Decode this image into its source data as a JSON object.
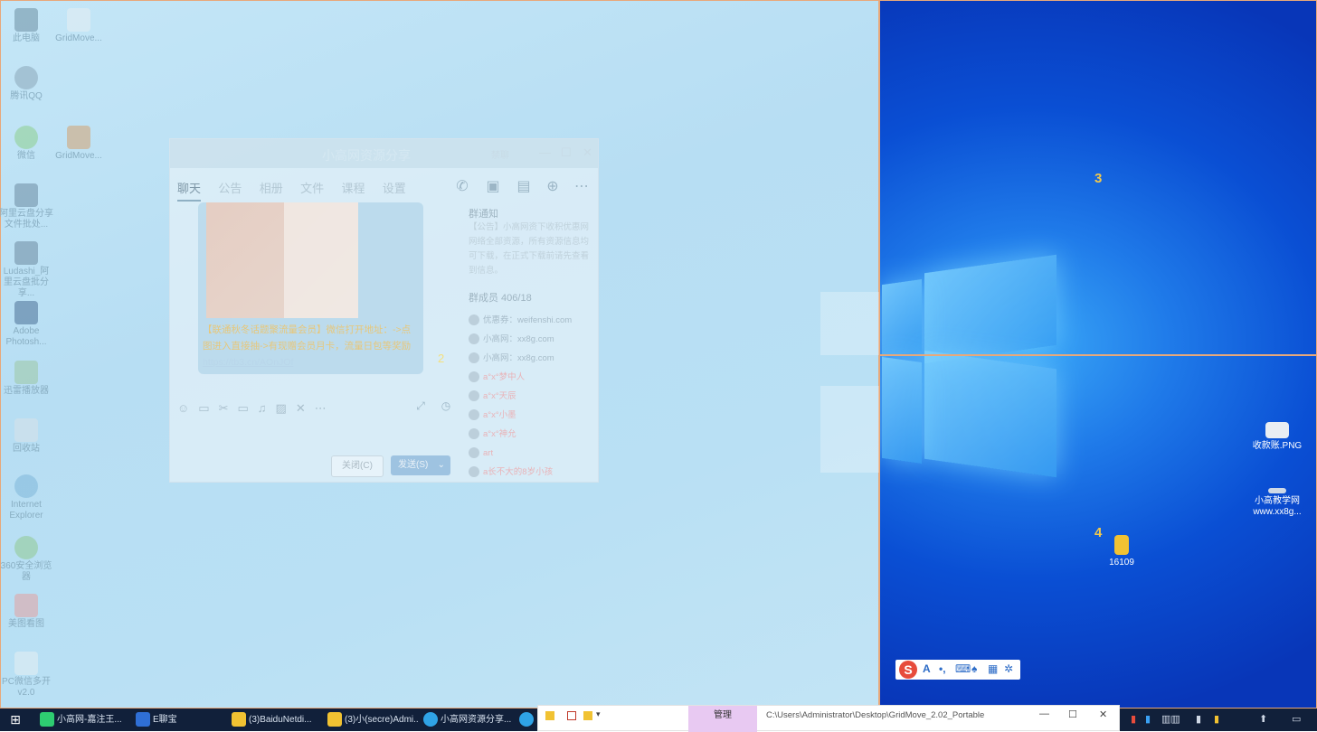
{
  "zones": {
    "zone2": "2",
    "zone3": "3",
    "zone4": "4"
  },
  "left_icons": [
    {
      "label": "此电脑"
    },
    {
      "label": "GridMove..."
    },
    {
      "label": "腾讯QQ"
    },
    {
      "label": "微信"
    },
    {
      "label": "GridMove..."
    },
    {
      "label": "阿里云盘分享文件批处..."
    },
    {
      "label": "Ludashi_阿里云盘批分享..."
    },
    {
      "label": "Adobe Photosh..."
    },
    {
      "label": "迅雷播放器"
    },
    {
      "label": "回收站"
    },
    {
      "label": "Internet Explorer"
    },
    {
      "label": "360安全浏览器"
    },
    {
      "label": "美图看图"
    },
    {
      "label": "PC微信多开 v2.0"
    }
  ],
  "right_icons": [
    {
      "label": "收款账.PNG"
    },
    {
      "label": "小高教学网 www.xx8g..."
    },
    {
      "label": "16109"
    }
  ],
  "chat": {
    "title": "小高网资源分享",
    "title_tag": "禁聊",
    "tabs": [
      "聊天",
      "公告",
      "相册",
      "文件",
      "课程",
      "设置"
    ],
    "message_text": "【联通秋冬话题聚流量会员】微信打开地址：->点图进入直接抽->有现赠会员月卡，流量日包等奖励",
    "message_link": "https://tb3.cn/AOnJOf",
    "read_count": "2",
    "group_notice_title": "群通知",
    "group_notice_text": "【公告】小高网资下收积优惠网网络全部资源，所有资源信息均可下载，在正式下载前请先查看到信息。",
    "members_title": "群成员 406/18",
    "members": [
      {
        "name": "优惠券：weifenshi.com",
        "pink": false
      },
      {
        "name": "小高网：xx8g.com",
        "pink": false
      },
      {
        "name": "小高网：xx8g.com",
        "pink": false
      },
      {
        "name": "a°x°梦中人",
        "pink": true
      },
      {
        "name": "a°x°天辰",
        "pink": true
      },
      {
        "name": "a°x°小墨",
        "pink": true
      },
      {
        "name": "a°x°神允",
        "pink": true
      },
      {
        "name": "art",
        "pink": true
      },
      {
        "name": "a长不大的8岁小孩",
        "pink": true
      }
    ],
    "close_button": "关闭(C)",
    "send_button": "发送(S)"
  },
  "taskbar": {
    "items": [
      "小高网-嘉注王...",
      "E聊宝",
      "(3)BaiduNetdi...",
      "(3)小(secre)Admi...",
      "小高网资源分享..."
    ]
  },
  "explorer": {
    "ribbon_tab": "管理",
    "path": "C:\\Users\\Administrator\\Desktop\\GridMove_2.02_Portable"
  },
  "ime": {
    "logo": "S",
    "mode": "A"
  },
  "colors": {
    "zone_border": "#e8a87a",
    "zone_number": "#f2c94c"
  }
}
